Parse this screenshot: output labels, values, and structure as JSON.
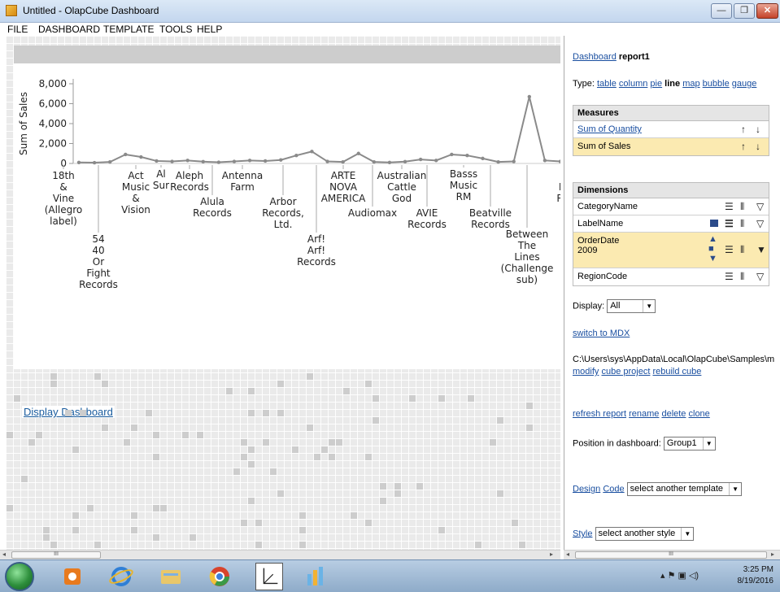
{
  "window": {
    "title": "Untitled - OlapCube Dashboard",
    "buttons": {
      "minimize": "—",
      "maximize": "❐",
      "close": "✕"
    }
  },
  "menu": [
    "FILE",
    "DASHBOARD",
    "TEMPLATE",
    "TOOLS",
    "HELP"
  ],
  "chart_data": {
    "type": "line",
    "ylabel": "Sum of Sales",
    "ylim": [
      0,
      8000
    ],
    "yticks": [
      "0",
      "2,000",
      "4,000",
      "6,000",
      "8,000"
    ],
    "categories": [
      "18th & Vine (Allegro label)",
      "54 40 Or Fight Records",
      "Act Music & Vision",
      "Al Sur",
      "Aleph Records",
      "Alula Records",
      "Antenna Farm",
      "Arbor Records, Ltd.",
      "Arf! Arf! Records",
      "ARTE NOVA AMERICA",
      "Audiomax",
      "Australian Cattle God",
      "AVIE Records",
      "Basss Music RM",
      "Beatville Records",
      "Between The Lines (Challenge sub)",
      "Bi Fl Re"
    ],
    "x_labels": [
      [
        "18th",
        "&",
        "Vine",
        "(Allegro",
        "label)"
      ],
      [
        "54",
        "40",
        "Or",
        "Fight",
        "Records"
      ],
      [
        "Act",
        "Music",
        "&",
        "Vision"
      ],
      [
        "Al",
        "Sur"
      ],
      [
        "Aleph",
        "Records"
      ],
      [
        "Alula",
        "Records"
      ],
      [
        "Antenna",
        "Farm"
      ],
      [
        "Arbor",
        "Records,",
        "Ltd."
      ],
      [
        "Arf!",
        "Arf!",
        "Records"
      ],
      [
        "ARTE",
        "NOVA",
        "AMERICA"
      ],
      [
        "Audiomax"
      ],
      [
        "Australian",
        "Cattle",
        "God"
      ],
      [
        "AVIE",
        "Records"
      ],
      [
        "Basss",
        "Music",
        "RM"
      ],
      [
        "Beatville",
        "Records"
      ],
      [
        "Between",
        "The",
        "Lines",
        "(Challenge",
        "sub)"
      ],
      [
        "B",
        "Fl",
        "Re"
      ]
    ],
    "values": [
      100,
      80,
      150,
      900,
      650,
      250,
      200,
      300,
      180,
      120,
      200,
      300,
      250,
      350,
      800,
      1200,
      200,
      150,
      1000,
      150,
      100,
      180,
      400,
      300,
      900,
      800,
      500,
      150,
      200,
      6700,
      300,
      200
    ],
    "grid": false
  },
  "links": {
    "display_dashboard": "Display Dashboard"
  },
  "panel": {
    "dashboard_link": "Dashboard",
    "report_name": "report1",
    "type_label": "Type:",
    "types": [
      "table",
      "column",
      "pie",
      "line",
      "map",
      "bubble",
      "gauge"
    ],
    "active_type": "line",
    "measures_title": "Measures",
    "measures": [
      {
        "label": "Sum of Quantity",
        "link": true
      },
      {
        "label": "Sum of Sales",
        "link": false
      }
    ],
    "dimensions_title": "Dimensions",
    "dimensions": [
      {
        "label": "CategoryName",
        "sub": ""
      },
      {
        "label": "LabelName",
        "sub": ""
      },
      {
        "label": "OrderDate",
        "sub": "2009"
      },
      {
        "label": "RegionCode",
        "sub": ""
      }
    ],
    "display_label": "Display:",
    "display_value": "All",
    "switch_mdx": "switch to MDX",
    "path": "C:\\Users\\sys\\AppData\\Local\\OlapCube\\Samples\\m",
    "cube_links": [
      "modify",
      "cube project",
      "rebuild cube"
    ],
    "report_links": [
      "refresh report",
      "rename",
      "delete",
      "clone"
    ],
    "position_label": "Position in dashboard:",
    "position_value": "Group1",
    "design_link": "Design",
    "code_link": "Code",
    "template_select": "select another template",
    "style_link": "Style",
    "style_select": "select another style"
  },
  "scroll": {
    "thumb": "III"
  },
  "tray": {
    "time": "3:25 PM",
    "date": "8/19/2016"
  }
}
